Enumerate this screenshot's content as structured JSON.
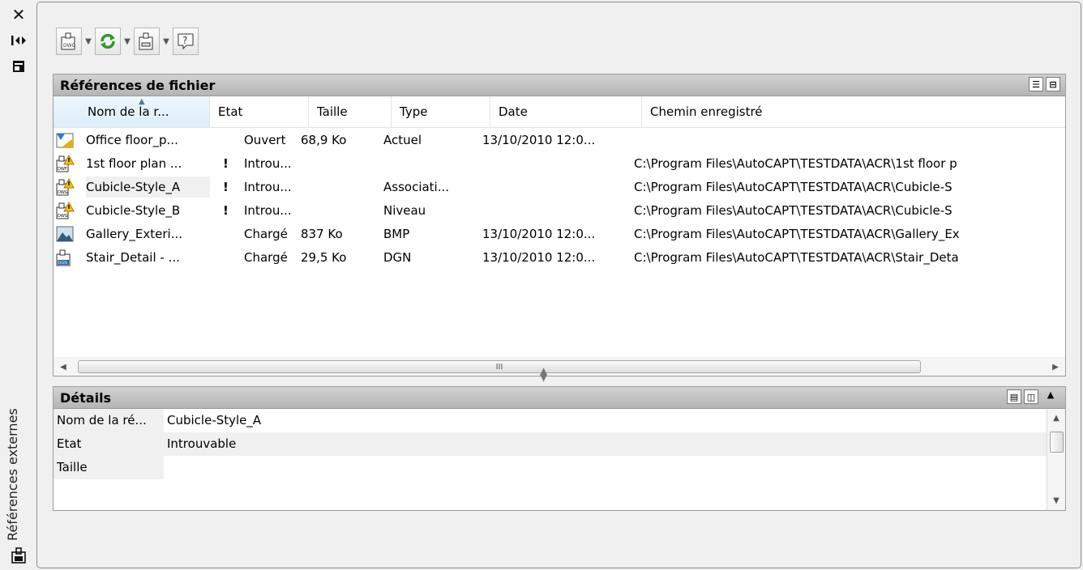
{
  "palette": "Références externes",
  "toolbar": {
    "buttons": [
      "attach-dwg",
      "refresh",
      "change-path",
      "help"
    ]
  },
  "file_refs": {
    "title": "Références de fichier",
    "columns": [
      "Nom de la r...",
      "Etat",
      "Taille",
      "Type",
      "Date",
      "Chemin enregistré"
    ],
    "rows": [
      {
        "icon": "drawing",
        "name": "Office floor_p...",
        "warn": "",
        "state": "Ouvert",
        "size": "68,9 Ko",
        "type": "Actuel",
        "date": "13/10/2010 12:0...",
        "path": ""
      },
      {
        "icon": "dwf-warning",
        "name": "1st floor plan ...",
        "warn": "!",
        "state": "Introu...",
        "size": "",
        "type": "",
        "date": "",
        "path": "C:\\Program Files\\AutoCAPT\\TESTDATA\\ACR\\1st floor p"
      },
      {
        "icon": "dwg-warning",
        "name": "Cubicle-Style_A",
        "warn": "!",
        "state": "Introu...",
        "size": "",
        "type": "Associati...",
        "date": "",
        "path": "C:\\Program Files\\AutoCAPT\\TESTDATA\\ACR\\Cubicle-S"
      },
      {
        "icon": "dwg-warning",
        "name": "Cubicle-Style_B",
        "warn": "!",
        "state": "Introu...",
        "size": "",
        "type": "Niveau",
        "date": "",
        "path": "C:\\Program Files\\AutoCAPT\\TESTDATA\\ACR\\Cubicle-S"
      },
      {
        "icon": "image",
        "name": "Gallery_Exteri...",
        "warn": "",
        "state": "Chargé",
        "size": "837 Ko",
        "type": "BMP",
        "date": "13/10/2010 12:0...",
        "path": "C:\\Program Files\\AutoCAPT\\TESTDATA\\ACR\\Gallery_Ex"
      },
      {
        "icon": "dgn",
        "name": "Stair_Detail - ...",
        "warn": "",
        "state": "Chargé",
        "size": "29,5 Ko",
        "type": "DGN",
        "date": "13/10/2010 12:0...",
        "path": "C:\\Program Files\\AutoCAPT\\TESTDATA\\ACR\\Stair_Deta"
      }
    ],
    "scroll_grip": "III"
  },
  "details": {
    "title": "Détails",
    "rows": [
      {
        "label": "Nom de la ré...",
        "value": "Cubicle-Style_A"
      },
      {
        "label": "Etat",
        "value": "Introuvable"
      },
      {
        "label": "Taille",
        "value": ""
      }
    ]
  }
}
